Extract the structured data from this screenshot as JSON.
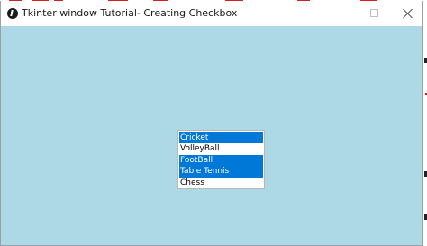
{
  "window": {
    "title": "Tkinter window Tutorial- Creating Checkbox",
    "background_color": "#add8e6",
    "controls": {
      "minimize_icon": "minimize-icon",
      "maximize_icon": "maximize-icon",
      "close_icon": "close-icon"
    }
  },
  "listbox": {
    "selection_color": "#0078d7",
    "items": [
      {
        "label": "Cricket",
        "selected": true
      },
      {
        "label": "VolleyBall",
        "selected": false
      },
      {
        "label": "FootBall",
        "selected": true
      },
      {
        "label": "Table Tennis",
        "selected": true
      },
      {
        "label": "Chess",
        "selected": false
      }
    ]
  }
}
